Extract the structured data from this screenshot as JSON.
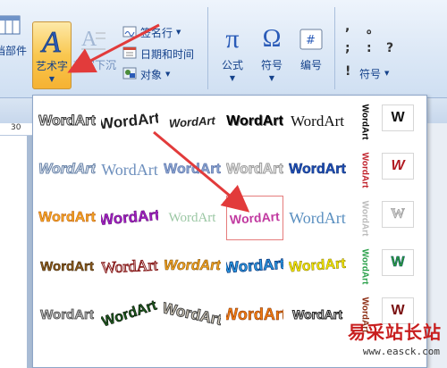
{
  "ribbon": {
    "parts_label": "档部件",
    "wordart_label": "艺术字",
    "dropcap_label": "首字下沉",
    "signature_label": "签名行",
    "datetime_label": "日期和时间",
    "object_label": "对象",
    "formula_label": "公式",
    "symbol_label": "符号",
    "number_label": "编号",
    "symbol_small_label": "符号",
    "symbols": [
      ",",
      "。",
      ";",
      ":",
      "?",
      "!"
    ]
  },
  "ruler": {
    "mark": "30"
  },
  "gallery": {
    "item_text": "WordArt",
    "w_text": "W"
  },
  "watermark": {
    "text": "易采站长站",
    "url": "www.easck.com"
  },
  "colors": {
    "accent": "#e23b3b",
    "wordart_highlight": "#f9c74f"
  },
  "icons": [
    "table-icon",
    "wordart-icon",
    "dropcap-icon",
    "signature-icon",
    "calendar-icon",
    "object-icon",
    "pi-icon",
    "omega-icon",
    "number-icon"
  ]
}
